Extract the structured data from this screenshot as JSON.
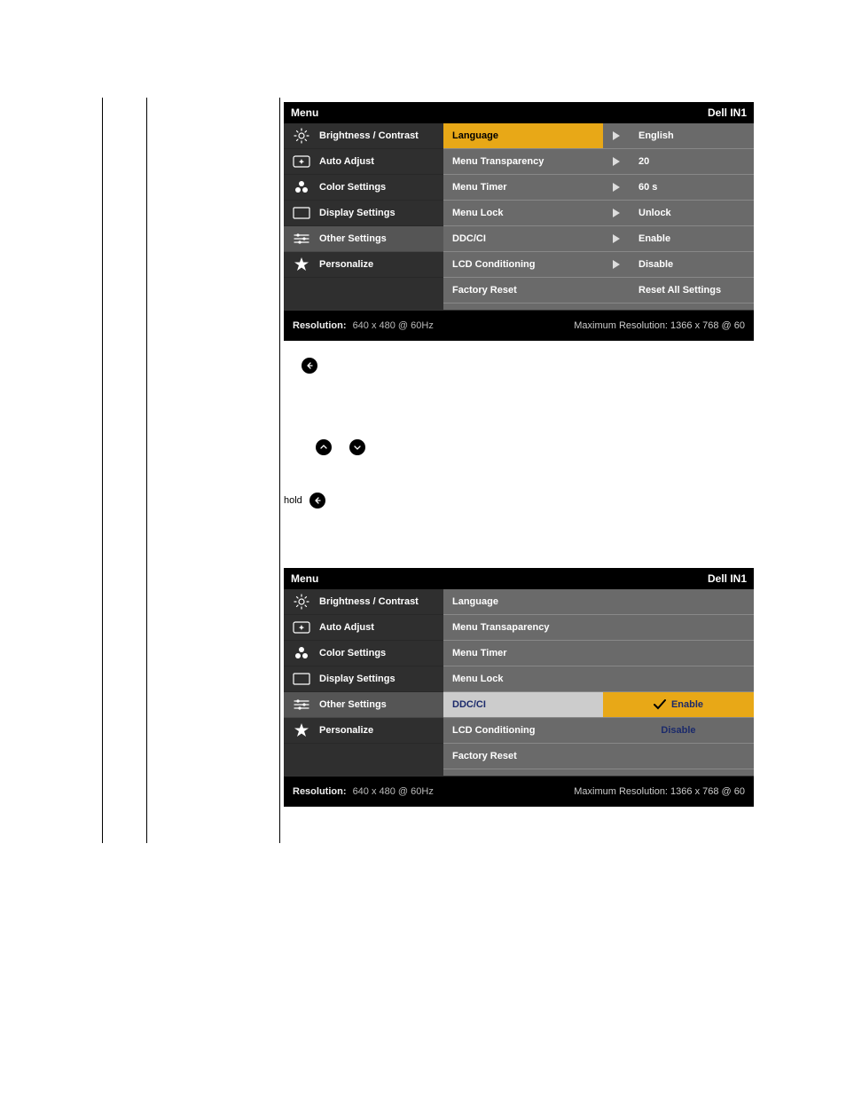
{
  "layout": {
    "vlines": [
      115,
      165,
      315
    ]
  },
  "osd1": {
    "title_left": "Menu",
    "title_right": "Dell IN1",
    "left_items": [
      {
        "icon": "brightness",
        "label": "Brightness / Contrast"
      },
      {
        "icon": "auto",
        "label": "Auto Adjust"
      },
      {
        "icon": "color",
        "label": "Color Settings"
      },
      {
        "icon": "display",
        "label": "Display Settings"
      },
      {
        "icon": "sliders",
        "label": "Other Settings",
        "selected": true
      },
      {
        "icon": "star",
        "label": "Personalize"
      }
    ],
    "right_items": [
      {
        "label": "Language",
        "arrow": true,
        "value": "English",
        "highlight": true
      },
      {
        "label": "Menu Transparency",
        "arrow": true,
        "value": "20"
      },
      {
        "label": "Menu Timer",
        "arrow": true,
        "value": "60 s"
      },
      {
        "label": "Menu Lock",
        "arrow": true,
        "value": "Unlock"
      },
      {
        "label": "DDC/CI",
        "arrow": true,
        "value": "Enable"
      },
      {
        "label": "LCD Conditioning",
        "arrow": true,
        "value": "Disable"
      },
      {
        "label": "Factory Reset",
        "arrow": false,
        "value": "Reset All Settings"
      }
    ],
    "footer": {
      "res_label": "Resolution:",
      "res_value": "640 x 480 @ 60Hz",
      "max_label": "Maximum Resolution: 1366 x 768 @ 60"
    }
  },
  "between": {
    "hold_label": "hold"
  },
  "osd2": {
    "title_left": "Menu",
    "title_right": "Dell IN1",
    "left_items": [
      {
        "icon": "brightness",
        "label": "Brightness / Contrast"
      },
      {
        "icon": "auto",
        "label": "Auto Adjust"
      },
      {
        "icon": "color",
        "label": "Color Settings"
      },
      {
        "icon": "display",
        "label": "Display Settings"
      },
      {
        "icon": "sliders",
        "label": "Other Settings",
        "selected": true
      },
      {
        "icon": "star",
        "label": "Personalize"
      }
    ],
    "right_items": [
      {
        "label": "Language"
      },
      {
        "label": "Menu Transaparency"
      },
      {
        "label": "Menu Timer"
      },
      {
        "label": "Menu Lock"
      },
      {
        "label": "DDC/CI",
        "option_highlight": true,
        "value": "Enable",
        "check": true
      },
      {
        "label": "LCD Conditioning",
        "option_dimmed": true,
        "value": "Disable"
      },
      {
        "label": "Factory Reset"
      }
    ],
    "footer": {
      "res_label": "Resolution:",
      "res_value": "640 x 480 @ 60Hz",
      "max_label": "Maximum Resolution: 1366 x 768 @ 60"
    }
  }
}
